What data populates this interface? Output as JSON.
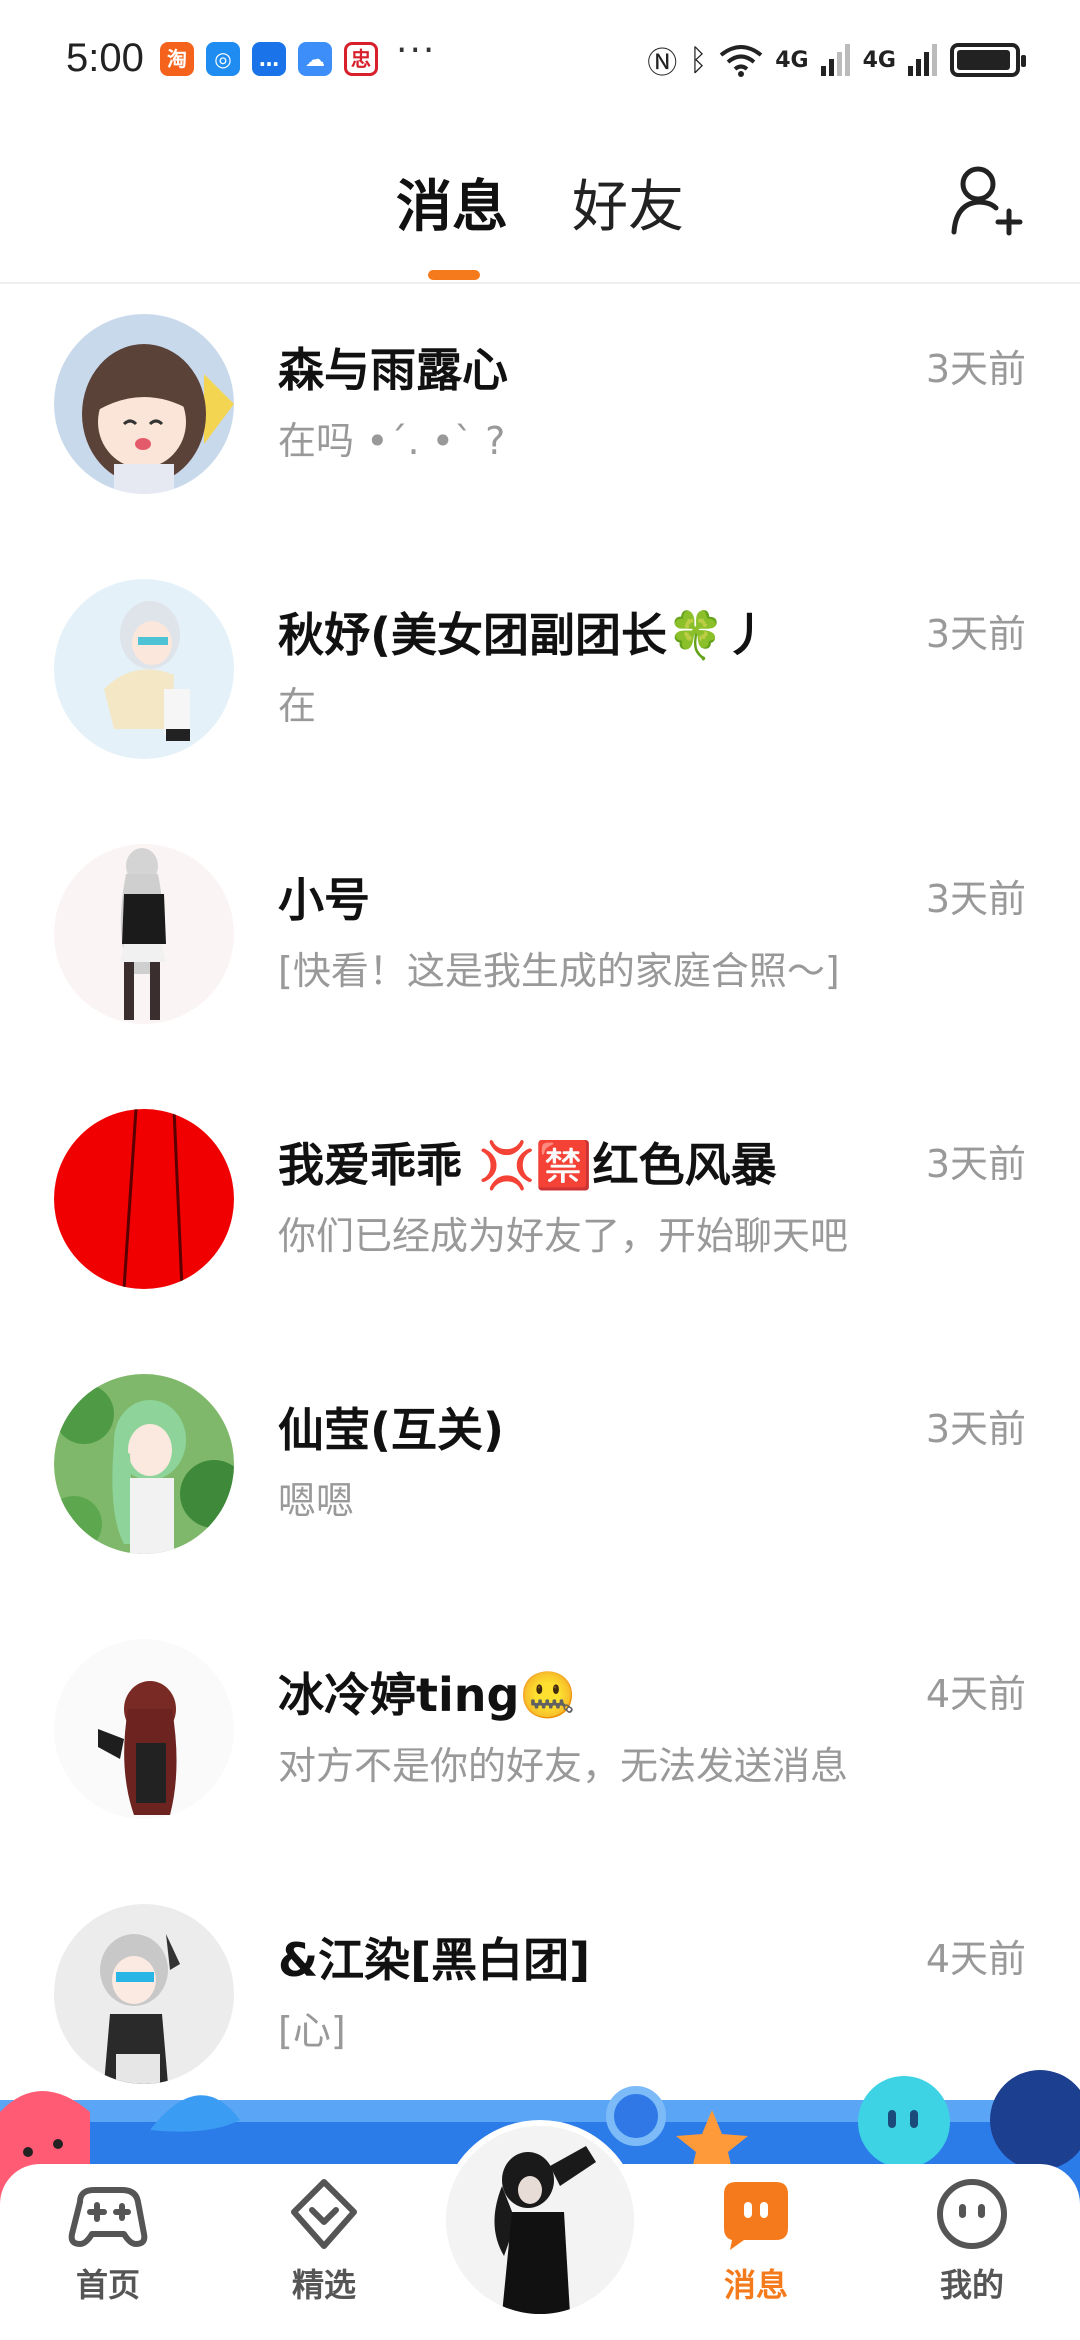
{
  "status_bar": {
    "time": "5:00",
    "apps": [
      {
        "icon": "taobao-icon",
        "glyph": "淘",
        "color": "#f5621c"
      },
      {
        "icon": "browser-icon",
        "glyph": "◎",
        "color": "#1e8cf0"
      },
      {
        "icon": "chat-icon",
        "glyph": "…",
        "color": "#1a73e8"
      },
      {
        "icon": "cloud-icon",
        "glyph": "☁",
        "color": "#3d8ef8"
      },
      {
        "icon": "app-icon",
        "glyph": "忠",
        "color": "#d7202b"
      }
    ],
    "more": "···",
    "network_1": "4G",
    "network_2": "4G",
    "battery_level": 0.95
  },
  "header": {
    "tabs": [
      {
        "label": "消息",
        "active": true
      },
      {
        "label": "好友",
        "active": false
      }
    ],
    "accent_color": "#f57a1c",
    "add_friend_icon": "add-user-icon"
  },
  "conversations": [
    {
      "name": "森与雨露心",
      "preview": "在吗 •ˊ. •ˋ ?",
      "time": "3天前"
    },
    {
      "name": "秋妤(美女团副团长🍀丿",
      "preview": "在",
      "time": "3天前"
    },
    {
      "name": "小号",
      "preview": "[快看！这是我生成的家庭合照～]",
      "time": "3天前"
    },
    {
      "name": "我爱乖乖 💢🈲红色风暴",
      "preview": "你们已经成为好友了，开始聊天吧",
      "time": "3天前"
    },
    {
      "name": "仙莹(互关)",
      "preview": "嗯嗯",
      "time": "3天前"
    },
    {
      "name": "冰冷婷ting🤐",
      "preview": "对方不是你的好友，无法发送消息",
      "time": "4天前"
    },
    {
      "name": "&江染[黑白团]",
      "preview": "[心]",
      "time": "4天前"
    }
  ],
  "bottom_nav": {
    "items": [
      {
        "label": "首页",
        "icon": "gamepad-icon",
        "active": false
      },
      {
        "label": "精选",
        "icon": "heart-badge-icon",
        "active": false
      },
      {
        "label": "消息",
        "icon": "message-icon",
        "active": true
      },
      {
        "label": "我的",
        "icon": "face-icon",
        "active": false
      }
    ]
  }
}
